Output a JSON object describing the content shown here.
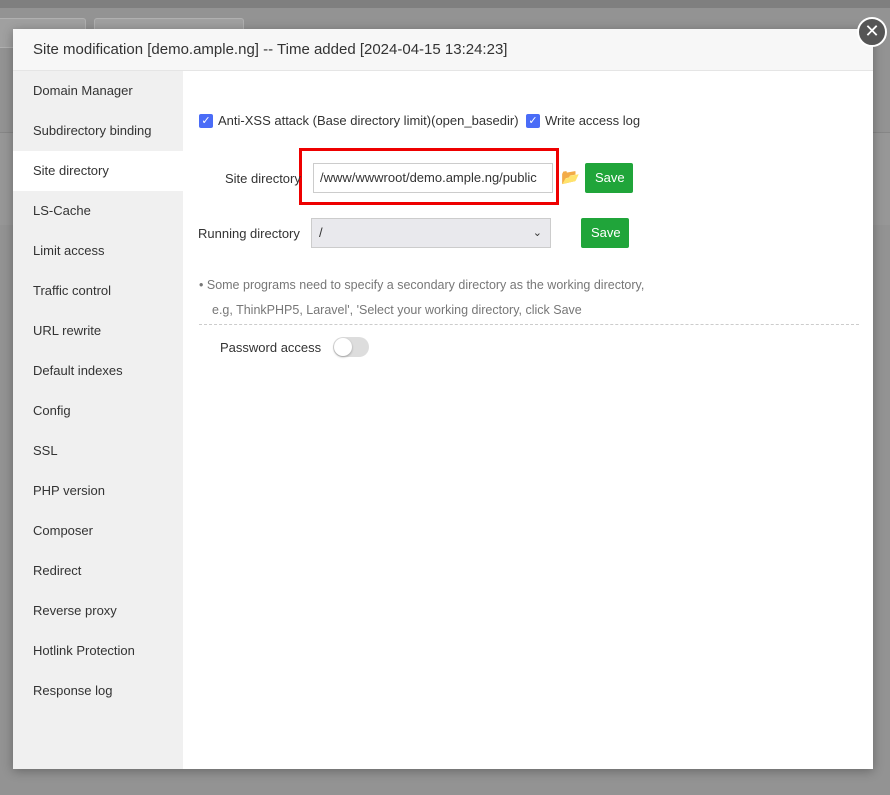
{
  "dialog": {
    "title": "Site modification [demo.ample.ng] -- Time added [2024-04-15 13:24:23]",
    "close_icon": "close-icon"
  },
  "sidebar": {
    "active": "Site directory",
    "items": [
      {
        "label": "Domain Manager"
      },
      {
        "label": "Subdirectory binding"
      },
      {
        "label": "Site directory"
      },
      {
        "label": "LS-Cache"
      },
      {
        "label": "Limit access"
      },
      {
        "label": "Traffic control"
      },
      {
        "label": "URL rewrite"
      },
      {
        "label": "Default indexes"
      },
      {
        "label": "Config"
      },
      {
        "label": "SSL"
      },
      {
        "label": "PHP version"
      },
      {
        "label": "Composer"
      },
      {
        "label": "Redirect"
      },
      {
        "label": "Reverse proxy"
      },
      {
        "label": "Hotlink Protection"
      },
      {
        "label": "Response log"
      }
    ]
  },
  "main": {
    "anti_xss": {
      "label": "Anti-XSS attack (Base directory limit)(open_basedir)",
      "checked": true
    },
    "access_log": {
      "label": "Write access log",
      "checked": true
    },
    "site_directory": {
      "label": "Site directory",
      "value": "/www/wwwroot/demo.ample.ng/public",
      "save": "Save"
    },
    "running_directory": {
      "label": "Running directory",
      "value": "/",
      "save": "Save"
    },
    "tip_line1": "Some programs need to specify a secondary directory as the working directory,",
    "tip_line2": "e.g, ThinkPHP5, Laravel', 'Select your working directory, click Save",
    "password_access": {
      "label": "Password access",
      "enabled": false
    }
  },
  "colors": {
    "accent": "#20a53a",
    "checkbox": "#4a6cf7",
    "highlight": "#e00000"
  }
}
